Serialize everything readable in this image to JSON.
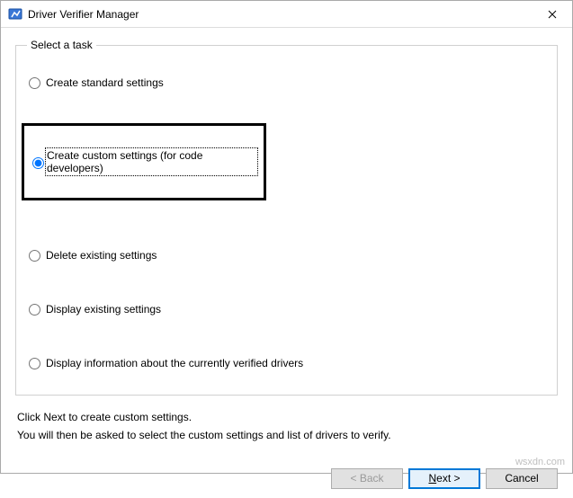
{
  "window": {
    "title": "Driver Verifier Manager"
  },
  "group": {
    "legend": "Select a task"
  },
  "options": {
    "create_standard": "Create standard settings",
    "create_custom": "Create custom settings (for code developers)",
    "delete_existing": "Delete existing settings",
    "display_existing": "Display existing settings",
    "display_info": "Display information about the currently verified drivers"
  },
  "instructions": {
    "line1": "Click Next to create custom settings.",
    "line2": "You will then be asked to select the custom settings and list of drivers to verify."
  },
  "buttons": {
    "back": "< Back",
    "next": "Next >",
    "cancel": "Cancel"
  },
  "watermark": "wsxdn.com"
}
